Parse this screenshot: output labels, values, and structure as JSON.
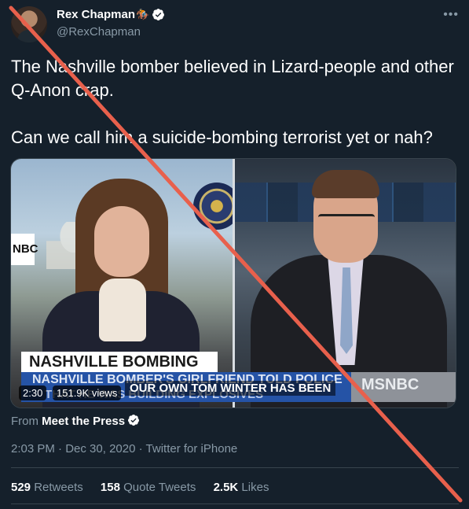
{
  "author": {
    "display_name": "Rex Chapman",
    "handle": "@RexChapman",
    "horse_emoji": "🏇",
    "verified_icon": "verified-badge-icon"
  },
  "more_icon": "•••",
  "tweet": {
    "text": "The Nashville bomber believed in Lizard-people and other Q-Anon crap.\n\nCan we call him a suicide-bombing terrorist yet or nah?"
  },
  "video": {
    "lower_third_title": "NASHVILLE BOMBING",
    "lower_third_line1": "NASHVILLE BOMBER'S GIRLFRIEND TOLD POLICE",
    "lower_third_line2": "THAT HE WAS BUILDING EXPLOSIVES",
    "network_left": "NBC",
    "network_right": "MSNBC",
    "caption": "OUR OWN TOM WINTER HAS BEEN",
    "duration": "2:30",
    "views": "151.9K views"
  },
  "source": {
    "prefix": "From",
    "name": "Meet the Press"
  },
  "meta": {
    "time": "2:03 PM",
    "date": "Dec 30, 2020",
    "client": "Twitter for iPhone",
    "separator": "·"
  },
  "stats": {
    "retweets_count": "529",
    "retweets_label": "Retweets",
    "quote_count": "158",
    "quote_label": "Quote Tweets",
    "likes_count": "2.5K",
    "likes_label": "Likes"
  },
  "colors": {
    "background": "#15202b",
    "secondary_text": "#8899a6",
    "verified_blue": "#1da1f2",
    "cross_out": "#e8604c"
  }
}
